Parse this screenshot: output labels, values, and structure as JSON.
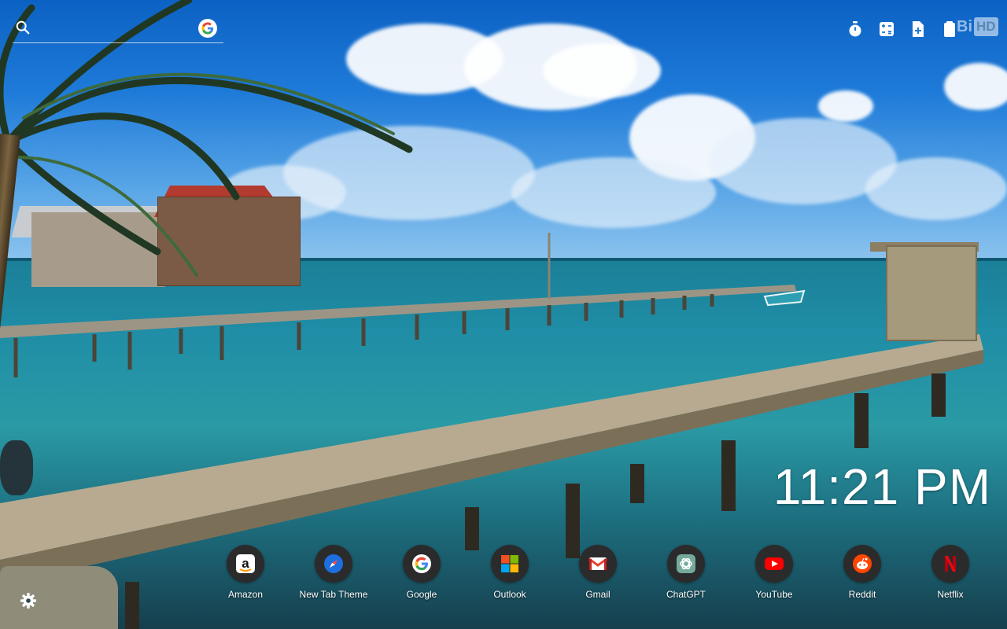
{
  "search": {
    "placeholder": "",
    "engine_icon": "google-icon"
  },
  "top_tools": [
    {
      "name": "timer-icon"
    },
    {
      "name": "calculator-icon"
    },
    {
      "name": "add-note-icon"
    },
    {
      "name": "todo-icon"
    }
  ],
  "brand": {
    "text": "Bi",
    "badge": "HD"
  },
  "clock": {
    "time": "11:21 PM"
  },
  "shortcuts": [
    {
      "label": "Amazon",
      "icon": "amazon-icon"
    },
    {
      "label": "New Tab Theme",
      "icon": "compass-icon"
    },
    {
      "label": "Google",
      "icon": "google-icon"
    },
    {
      "label": "Outlook",
      "icon": "microsoft-icon"
    },
    {
      "label": "Gmail",
      "icon": "gmail-icon"
    },
    {
      "label": "ChatGPT",
      "icon": "chatgpt-icon"
    },
    {
      "label": "YouTube",
      "icon": "youtube-icon"
    },
    {
      "label": "Reddit",
      "icon": "reddit-icon"
    },
    {
      "label": "Netflix",
      "icon": "netflix-icon"
    }
  ],
  "settings": {
    "icon": "gear-icon"
  },
  "colors": {
    "icon_circle": "#2b2b2b",
    "text": "#ffffff"
  }
}
